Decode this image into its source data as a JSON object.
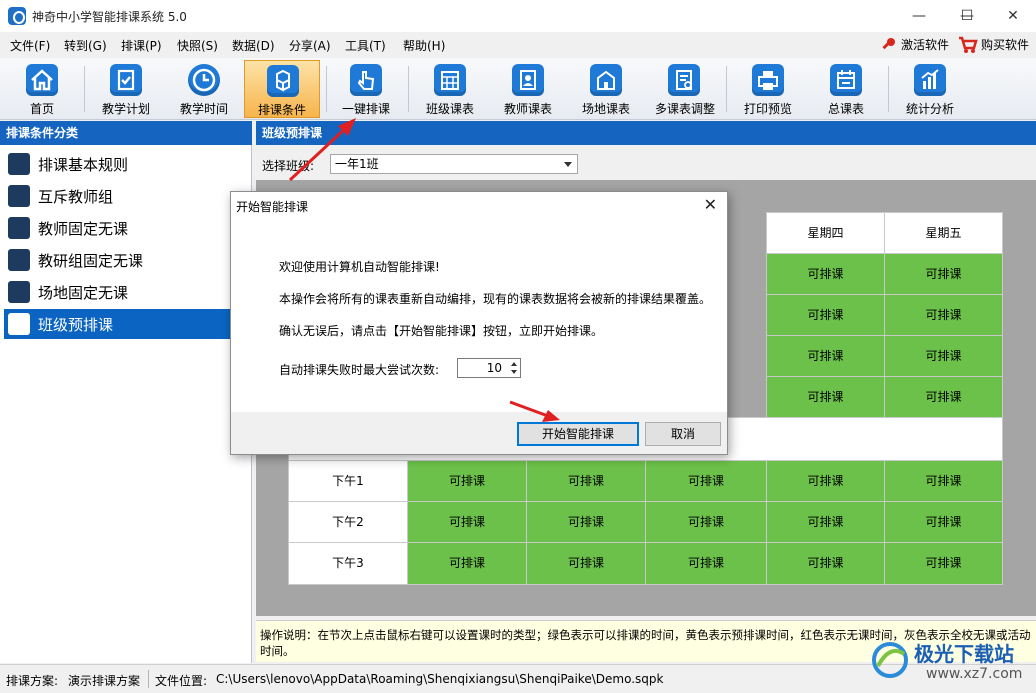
{
  "window": {
    "title": "神奇中小学智能排课系统 5.0",
    "minimize": "—",
    "maximize": "☐",
    "close": "✕"
  },
  "menu": {
    "items": [
      "文件(F)",
      "转到(G)",
      "排课(P)",
      "快照(S)",
      "数据(D)",
      "分享(A)",
      "工具(T)",
      "帮助(H)"
    ],
    "activate": "激活软件",
    "buy": "购买软件"
  },
  "toolbar": {
    "items": [
      {
        "label": "首页",
        "icon": "home-icon"
      },
      {
        "label": "教学计划",
        "icon": "clipboard-check-icon"
      },
      {
        "label": "教学时间",
        "icon": "clock-icon"
      },
      {
        "label": "排课条件",
        "icon": "cubes-icon"
      },
      {
        "label": "一键排课",
        "icon": "pointer-hand-icon"
      },
      {
        "label": "班级课表",
        "icon": "calendar-grid-icon"
      },
      {
        "label": "教师课表",
        "icon": "teacher-card-icon"
      },
      {
        "label": "场地课表",
        "icon": "building-icon"
      },
      {
        "label": "多课表调整",
        "icon": "adjust-sheet-icon"
      },
      {
        "label": "打印预览",
        "icon": "printer-icon"
      },
      {
        "label": "总课表",
        "icon": "schedule-icon"
      },
      {
        "label": "统计分析",
        "icon": "bar-chart-icon"
      }
    ],
    "active": "排课条件"
  },
  "left_panel": {
    "header": "排课条件分类",
    "items": [
      {
        "label": "排课基本规则",
        "icon": "rules-icon"
      },
      {
        "label": "互斥教师组",
        "icon": "exclusive-teachers-icon"
      },
      {
        "label": "教师固定无课",
        "icon": "teacher-icon"
      },
      {
        "label": "教研组固定无课",
        "icon": "cube-icon"
      },
      {
        "label": "场地固定无课",
        "icon": "venue-icon"
      },
      {
        "label": "班级预排课",
        "icon": "book-icon"
      }
    ],
    "selected": "班级预排课"
  },
  "right_panel": {
    "header": "班级预排课",
    "class_label": "选择班级:",
    "class_value": "一年1班",
    "days_visible": [
      "星期四",
      "星期五"
    ],
    "cell_text": "可排课",
    "afternoon_rows": [
      "下午1",
      "下午2",
      "下午3"
    ],
    "note": "操作说明：在节次上点击鼠标右键可以设置课时的类型；绿色表示可以排课的时间，黄色表示预排课时间，红色表示无课时间，灰色表示全校无课或活动时间。"
  },
  "colors": {
    "available": "#6cc14a",
    "header_blue": "#1565c0",
    "selected_blue": "#0b64c2",
    "arrow_red": "#e02020"
  },
  "dialog": {
    "title": "开始智能排课",
    "close": "✕",
    "line1": "欢迎使用计算机自动智能排课!",
    "line2": "本操作会将所有的课表重新自动编排，现有的课表数据将会被新的排课结果覆盖。",
    "line3": "确认无误后，请点击【开始智能排课】按钮，立即开始排课。",
    "retry_label": "自动排课失败时最大尝试次数:",
    "retry_value": "10",
    "start_button": "开始智能排课",
    "cancel_button": "取消"
  },
  "status": {
    "plan_label": "排课方案:",
    "plan_value": "演示排课方案",
    "file_label": "文件位置:",
    "file_value": "C:\\Users\\lenovo\\AppData\\Roaming\\Shenqixiangsu\\ShenqiPaike\\Demo.sqpk"
  },
  "watermark": {
    "name": "极光下载站",
    "url": "www.xz7.com"
  }
}
